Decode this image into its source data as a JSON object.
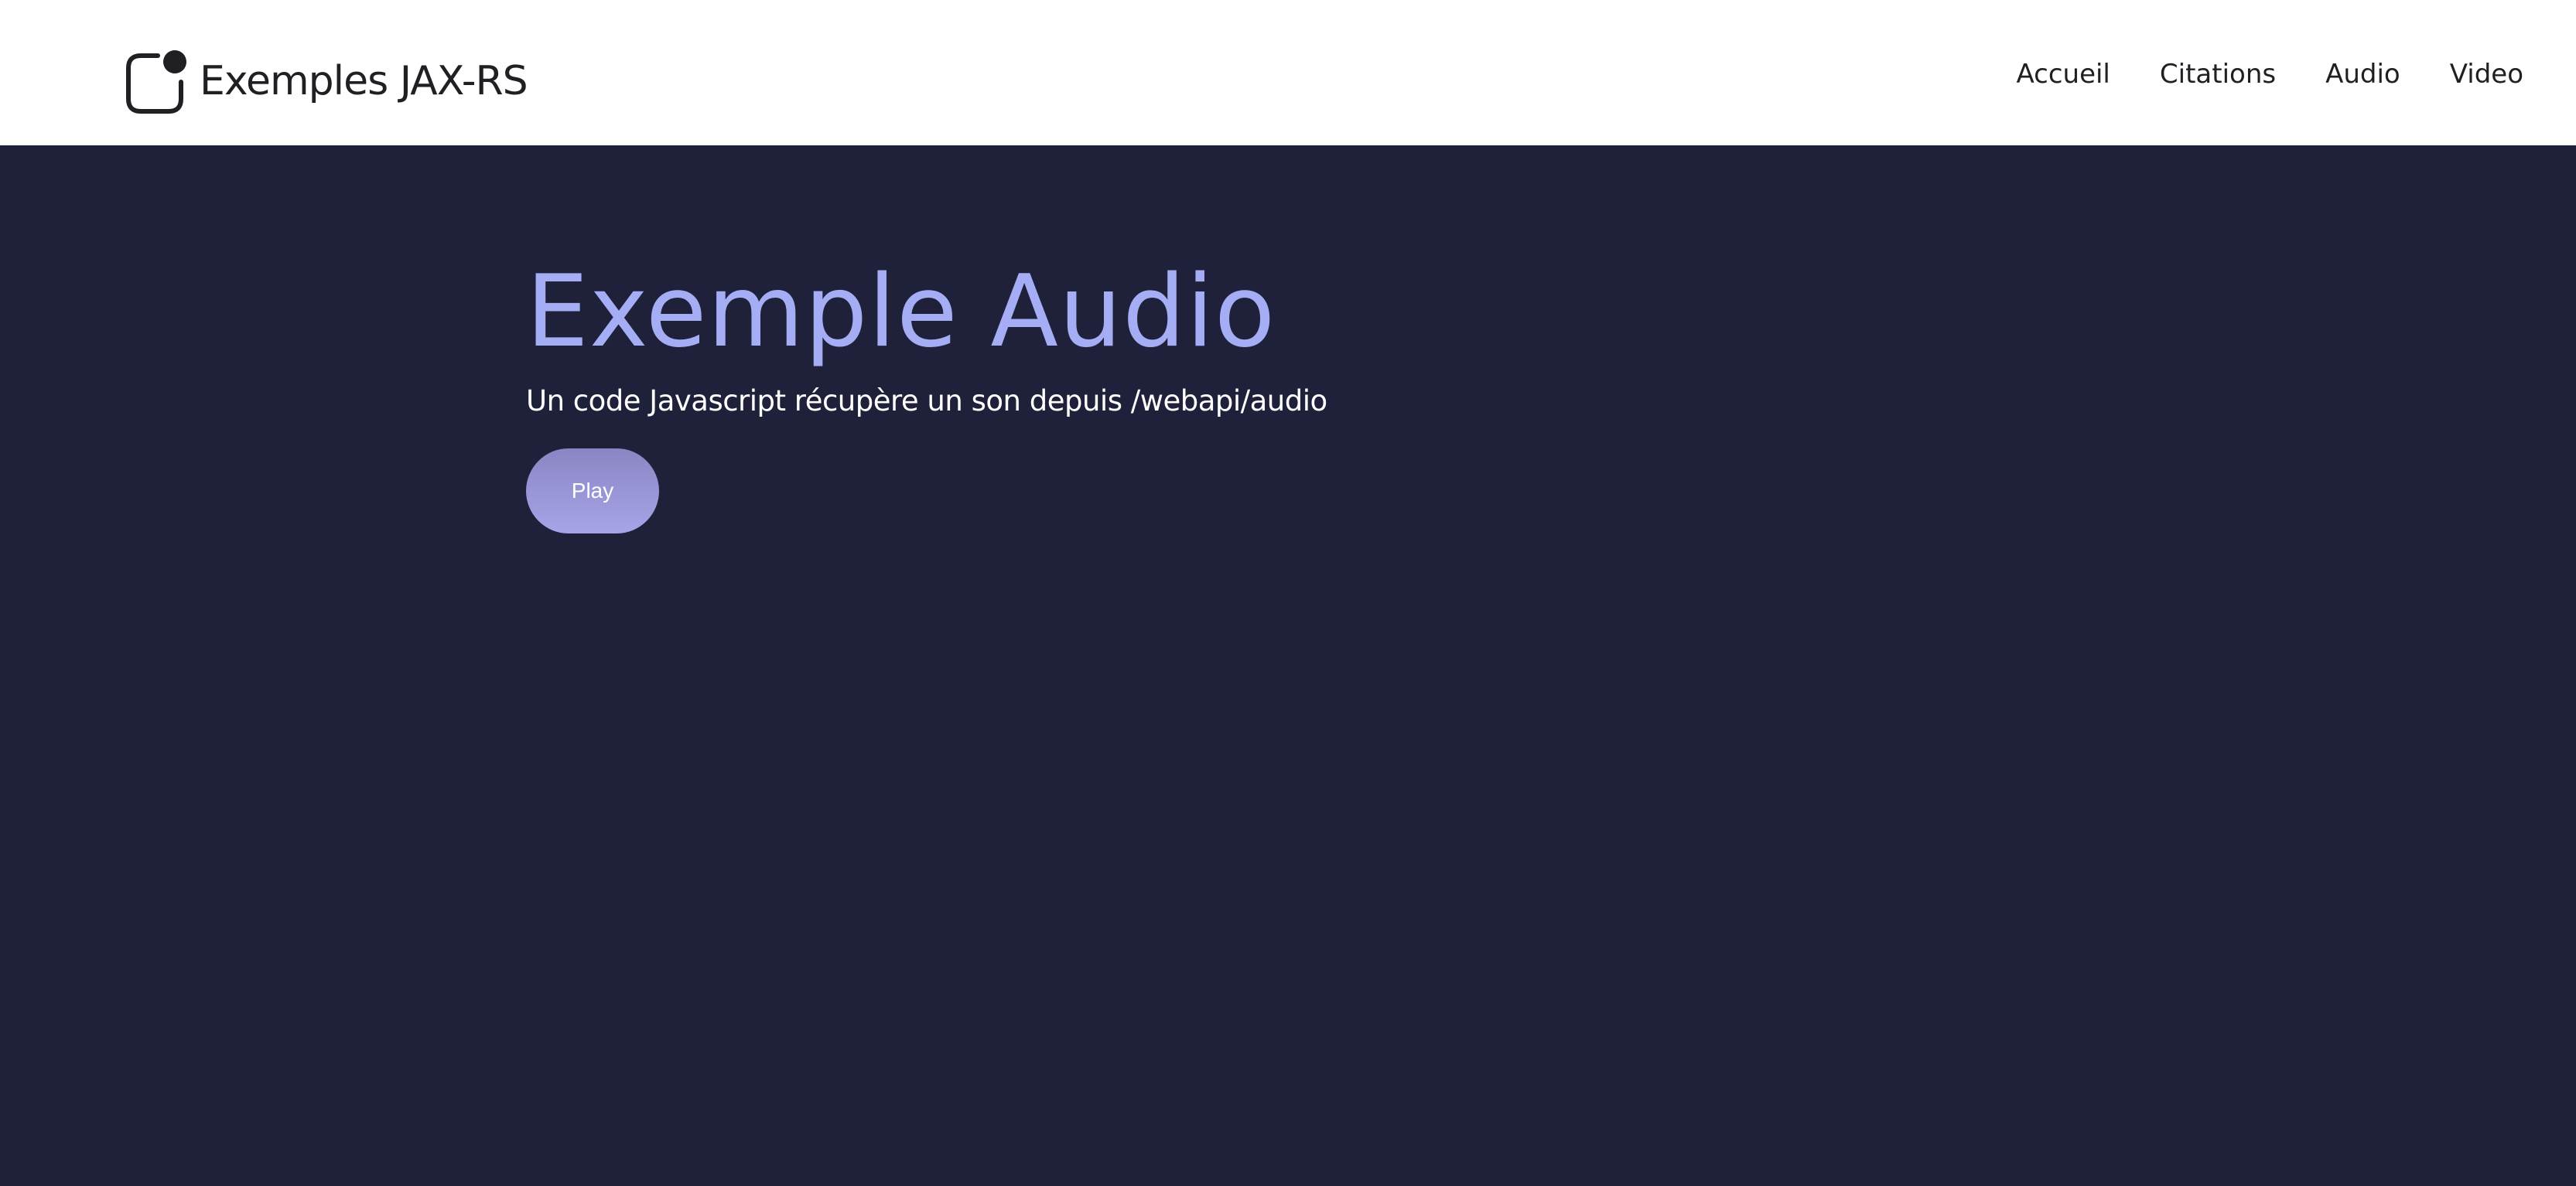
{
  "header": {
    "brand": "Exemples JAX-RS",
    "logo_icon": "rounded-square-dot-icon",
    "nav": [
      {
        "label": "Accueil"
      },
      {
        "label": "Citations"
      },
      {
        "label": "Audio"
      },
      {
        "label": "Video"
      }
    ]
  },
  "hero": {
    "title": "Exemple Audio",
    "subtitle": "Un code Javascript récupère un son depuis /webapi/audio",
    "play_label": "Play"
  },
  "colors": {
    "background": "#1f2039",
    "header": "#ffffff",
    "title": "#a5aef5",
    "button_start": "#8a86c4",
    "button_end": "#a7a4e8"
  }
}
